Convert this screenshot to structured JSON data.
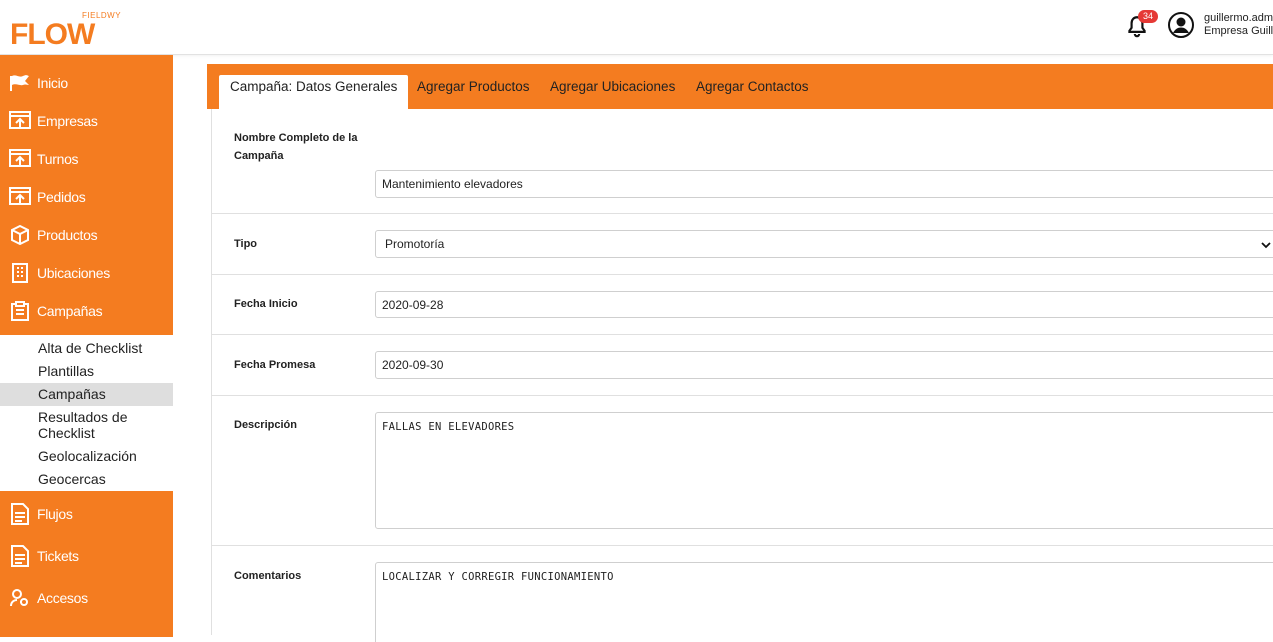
{
  "header": {
    "logo_sub": "FIELDWY",
    "logo_main": "FLOW",
    "notification_count": "34",
    "user_name": "guillermo.admin",
    "user_company": "Empresa Guillermo",
    "icons": [
      "bell-icon",
      "user-avatar-icon"
    ]
  },
  "sidebar": {
    "top_items": [
      {
        "label": "Inicio",
        "icon": "flag-icon"
      },
      {
        "label": "Empresas",
        "icon": "upload-board-icon"
      },
      {
        "label": "Turnos",
        "icon": "upload-board-icon"
      },
      {
        "label": "Pedidos",
        "icon": "upload-board-icon"
      },
      {
        "label": "Productos",
        "icon": "box-icon"
      },
      {
        "label": "Ubicaciones",
        "icon": "building-icon"
      },
      {
        "label": "Campañas",
        "icon": "clipboard-icon"
      }
    ],
    "sub_items": [
      {
        "label": "Alta de Checklist"
      },
      {
        "label": "Plantillas"
      },
      {
        "label": "Campañas",
        "active": true
      },
      {
        "label": "Resultados de Checklist"
      },
      {
        "label": "Geolocalización"
      },
      {
        "label": "Geocercas"
      }
    ],
    "bottom_items": [
      {
        "label": "Flujos",
        "icon": "document-icon"
      },
      {
        "label": "Tickets",
        "icon": "document-icon"
      },
      {
        "label": "Accesos",
        "icon": "users-key-icon"
      }
    ]
  },
  "tabs": [
    {
      "label": "Campaña: Datos Generales",
      "active": true
    },
    {
      "label": "Agregar Productos"
    },
    {
      "label": "Agregar Ubicaciones"
    },
    {
      "label": "Agregar Contactos"
    }
  ],
  "form": {
    "nombre_label": "Nombre Completo de la Campaña",
    "nombre_value": "Mantenimiento elevadores",
    "tipo_label": "Tipo",
    "tipo_value": "Promotoría",
    "fecha_inicio_label": "Fecha Inicio",
    "fecha_inicio_value": "2020-09-28",
    "fecha_promesa_label": "Fecha Promesa",
    "fecha_promesa_value": "2020-09-30",
    "descripcion_label": "Descripción",
    "descripcion_value": "FALLAS EN ELEVADORES",
    "comentarios_label": "Comentarios",
    "comentarios_value": "LOCALIZAR Y CORREGIR FUNCIONAMIENTO"
  },
  "colors": {
    "accent": "#f47c20",
    "badge": "#e53935",
    "active_sub": "#dedede"
  }
}
